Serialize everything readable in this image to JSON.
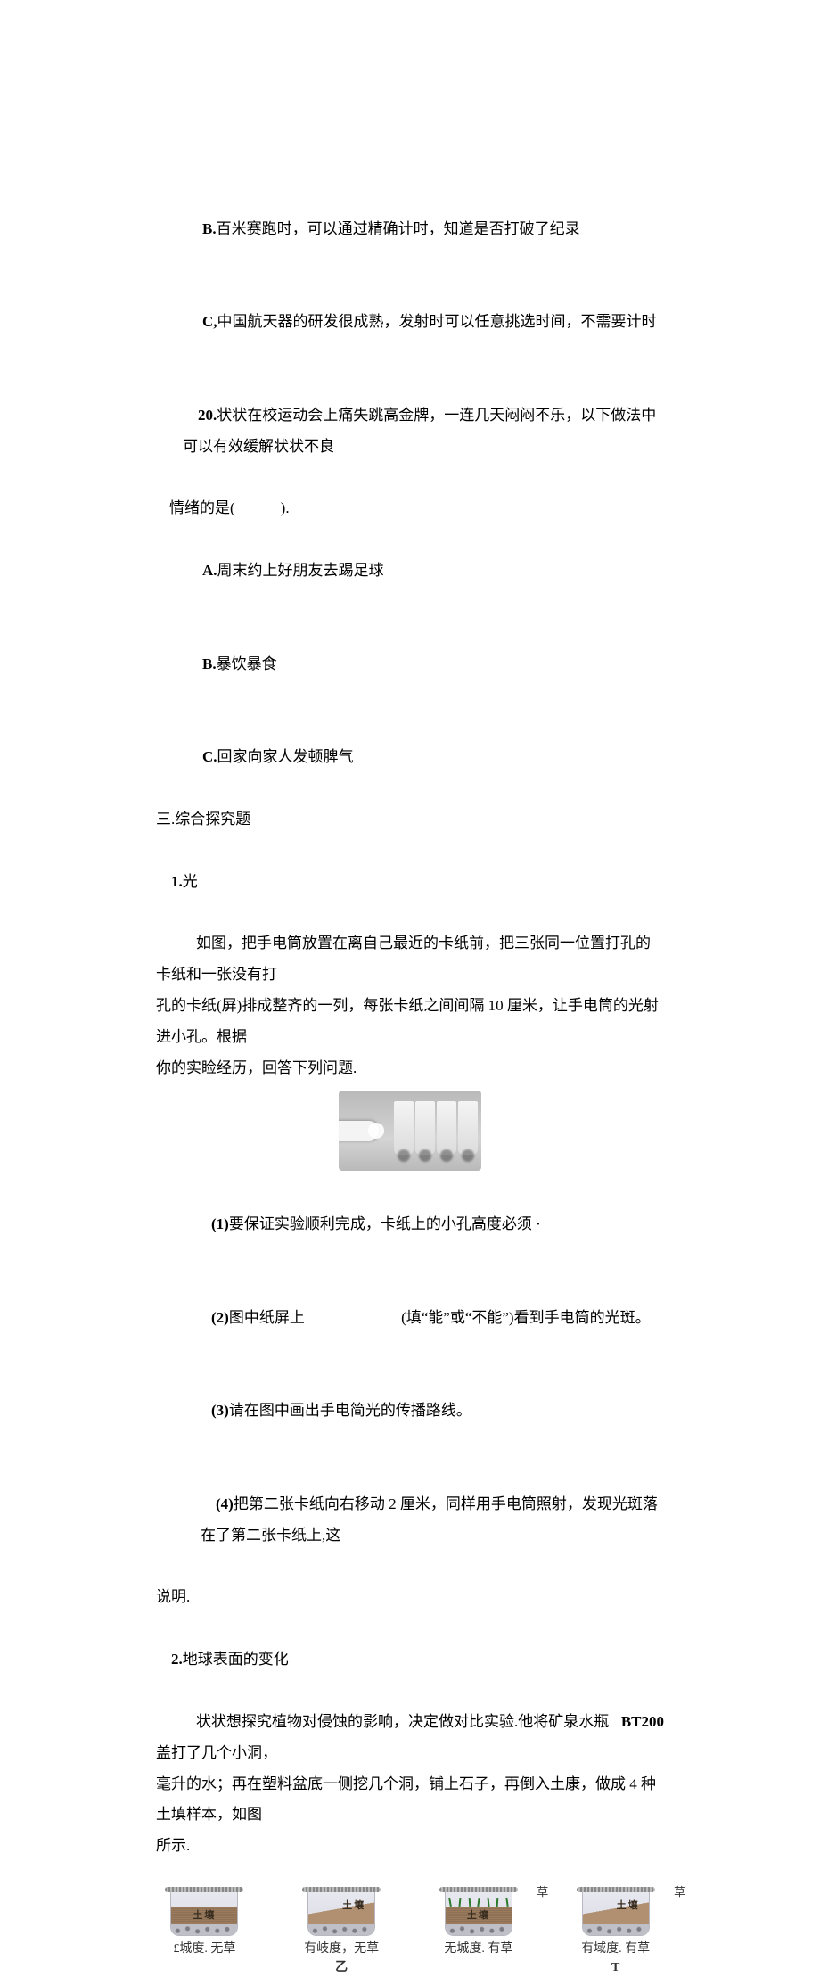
{
  "q19": {
    "bText": "百米赛跑时，可以通过精确计时，知道是否打破了纪录",
    "cText": "中国航天器的研发很成熟，发射时可以任意挑选时间，不需要计时"
  },
  "q20": {
    "stem1": "状状在校运动会上痛失跳高金牌，一连几天闷闷不乐，以下做法中可以有效缓解状状不良",
    "stem2": "情绪的是(            ).",
    "aText": "周末约上好朋友去踢足球",
    "bText": "暴饮暴食",
    "cText": "回家向家人发顿脾气"
  },
  "sectionHeader": "三.综合探究题",
  "p1": {
    "title": "光",
    "para1_l1": "如图，把手电筒放置在离自己最近的卡纸前，把三张同一位置打孔的卡纸和一张没有打",
    "para1_l2": "孔的卡纸(屏)排成整齐的一列，每张卡纸之间间隔 10 厘米，让手电筒的光射进小孔。根据",
    "para1_l3": "你的实睑经历，回答下列问题.",
    "sub1": "要保证实验顺利完成，卡纸上的小孔高度必须 ·",
    "sub2_pre": "图中纸屏上 ",
    "sub2_post": "(填“能”或“不能”)看到手电筒的光斑。",
    "sub3": "请在图中画出手电简光的传播路线。",
    "sub4_l1": "把第二张卡纸向右移动 2 厘米，同样用手电筒照射，发现光斑落在了第二张卡纸上,这",
    "sub4_l2": "说明."
  },
  "p2": {
    "title": "地球表面的变化",
    "para1_l1": "状状想探究植物对侵蚀的影响，决定做对比实验.他将矿泉水瓶盖打了几个小洞，",
    "para1_l1_tail": "BT200",
    "para1_l2": "毫升的水；再在塑料盆底一侧挖几个洞，铺上石子，再倒入土康，做成 4 种土填样本，如图",
    "para1_l3": "所示.",
    "soilLabel": "土壤",
    "samples": [
      {
        "cap": "£城度. 无草",
        "sub": ""
      },
      {
        "cap": "有岐度，无草",
        "sub": "乙"
      },
      {
        "cap": "无城度. 有草",
        "sub": ""
      },
      {
        "cap": "有域度. 有草",
        "sub": "T"
      }
    ],
    "grassTag": "草"
  },
  "labels": {
    "B": "B.",
    "C": "C,",
    "C2": "C.",
    "A": "A.",
    "n20": "20.",
    "n1": "1.",
    "n2": "2.",
    "s1": "(1)",
    "s2": "(2)",
    "s3": "(3)",
    "s4": "(4)"
  }
}
